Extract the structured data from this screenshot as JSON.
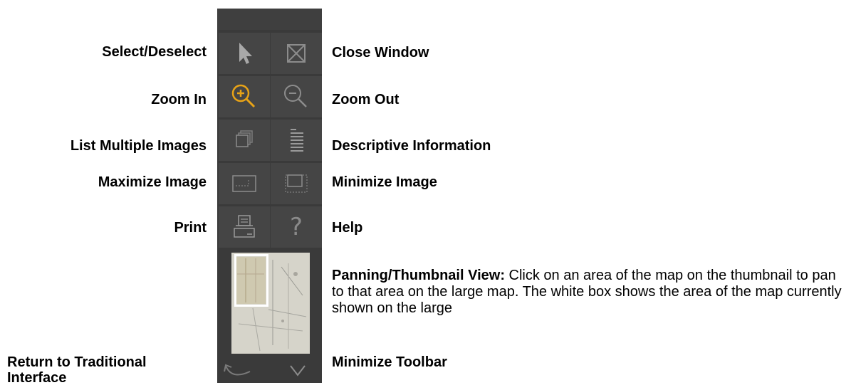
{
  "left_labels": {
    "select": "Select/Deselect",
    "zoom_in": "Zoom In",
    "list_multiple": "List Multiple Images",
    "maximize": "Maximize Image",
    "print": "Print",
    "return_traditional": "Return to Traditional Interface"
  },
  "right_labels": {
    "close_window": "Close Window",
    "zoom_out": "Zoom Out",
    "descriptive_info": "Descriptive Information",
    "minimize_image": "Minimize Image",
    "help": "Help",
    "panning_title": "Panning/Thumbnail View:",
    "panning_desc": " Click on an area of the map on the thumbnail to pan to that area on the large map. The white box shows the area of the map currently shown on the large",
    "minimize_toolbar": "Minimize Toolbar"
  },
  "icons": {
    "select": "cursor-arrow-icon",
    "close": "close-window-icon",
    "zoom_in": "zoom-in-icon",
    "zoom_out": "zoom-out-icon",
    "list_multiple": "stacked-pages-icon",
    "descriptive": "lines-document-icon",
    "maximize": "maximize-window-icon",
    "minimize": "minimize-window-icon",
    "print": "printer-icon",
    "help": "question-mark-icon",
    "return": "curved-arrow-icon",
    "minimize_toolbar": "chevron-down-icon"
  },
  "help_glyph": "?",
  "colors": {
    "toolbar_bg": "#3a3a3a",
    "button_bg": "#454545",
    "icon_gray": "#9a9a9a",
    "zoom_in_accent": "#e8a317"
  }
}
